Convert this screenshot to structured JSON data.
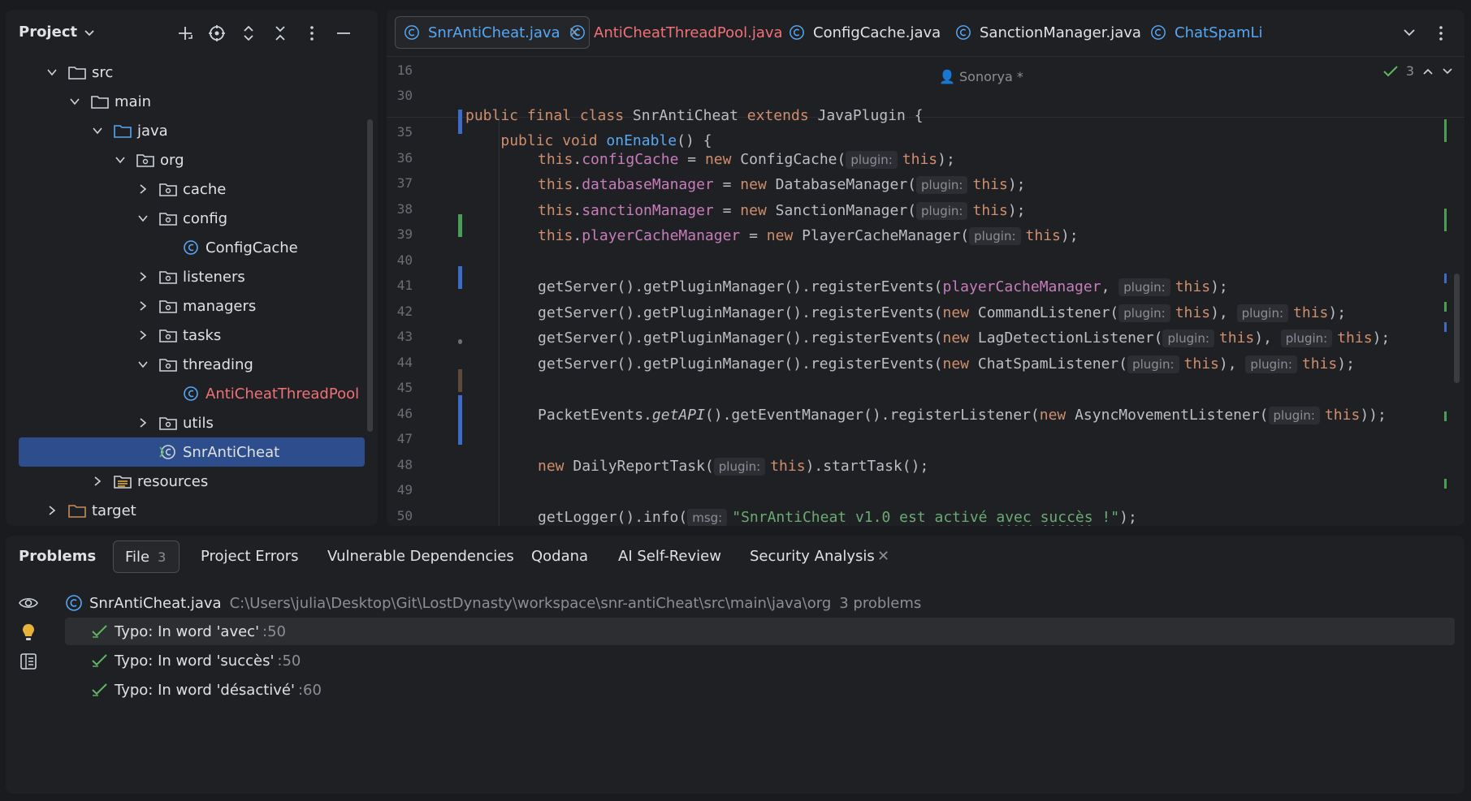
{
  "project": {
    "title": "Project",
    "tree": [
      {
        "label": "src",
        "kind": "folder",
        "expanded": true,
        "depth": 0
      },
      {
        "label": "main",
        "kind": "folder",
        "expanded": true,
        "depth": 1
      },
      {
        "label": "java",
        "kind": "source-folder",
        "expanded": true,
        "depth": 2
      },
      {
        "label": "org",
        "kind": "package",
        "expanded": true,
        "depth": 3
      },
      {
        "label": "cache",
        "kind": "package",
        "expanded": false,
        "depth": 4
      },
      {
        "label": "config",
        "kind": "package",
        "expanded": true,
        "depth": 4
      },
      {
        "label": "ConfigCache",
        "kind": "class",
        "depth": 5
      },
      {
        "label": "listeners",
        "kind": "package",
        "expanded": false,
        "depth": 4
      },
      {
        "label": "managers",
        "kind": "package",
        "expanded": false,
        "depth": 4
      },
      {
        "label": "tasks",
        "kind": "package",
        "expanded": false,
        "depth": 4
      },
      {
        "label": "threading",
        "kind": "package",
        "expanded": true,
        "depth": 4
      },
      {
        "label": "AntiCheatThreadPool",
        "kind": "class-error",
        "depth": 5
      },
      {
        "label": "utils",
        "kind": "package",
        "expanded": false,
        "depth": 4
      },
      {
        "label": "SnrAntiCheat",
        "kind": "main-class",
        "depth": 4,
        "selected": true
      },
      {
        "label": "resources",
        "kind": "resources-folder",
        "expanded": false,
        "depth": 2
      },
      {
        "label": "target",
        "kind": "folder-excluded",
        "expanded": false,
        "depth": 0
      }
    ]
  },
  "editor": {
    "tabs": [
      {
        "label": "SnrAntiCheat.java",
        "active": true,
        "color": "#56a8f5"
      },
      {
        "label": "AntiCheatThreadPool.java",
        "active": false,
        "color": "#f07178"
      },
      {
        "label": "ConfigCache.java",
        "active": false,
        "color": "#dfe1e5"
      },
      {
        "label": "SanctionManager.java",
        "active": false,
        "color": "#dfe1e5"
      },
      {
        "label": "ChatSpamLi",
        "active": false,
        "color": "#56a8f5"
      }
    ],
    "author": "Sonorya *",
    "inspection_count": "3",
    "sticky": [
      {
        "ln": "16",
        "code": "public final class SnrAntiCheat extends JavaPlugin {"
      },
      {
        "ln": "30",
        "code": "    public void onEnable() {"
      }
    ],
    "line_numbers": [
      "35",
      "36",
      "37",
      "38",
      "39",
      "40",
      "41",
      "42",
      "43",
      "44",
      "45",
      "46",
      "47",
      "48",
      "49",
      "50"
    ],
    "hint_plugin": "plugin:",
    "hint_msg": "msg:",
    "log_message": "\"SnrAntiCheat v1.0 est activé avec succès !\""
  },
  "problems": {
    "title": "Problems",
    "tabs": [
      {
        "label": "File",
        "count": "3"
      },
      {
        "label": "Project Errors"
      },
      {
        "label": "Vulnerable Dependencies"
      },
      {
        "label": "Qodana"
      },
      {
        "label": "AI Self-Review"
      },
      {
        "label": "Security Analysis"
      }
    ],
    "file": {
      "name": "SnrAntiCheat.java",
      "path": "C:\\Users\\julia\\Desktop\\Git\\LostDynasty\\workspace\\snr-antiCheat\\src\\main\\java\\org",
      "count": "3 problems"
    },
    "items": [
      {
        "text": "Typo: In word 'avec'",
        "line": ":50"
      },
      {
        "text": "Typo: In word 'succès'",
        "line": ":50"
      },
      {
        "text": "Typo: In word 'désactivé'",
        "line": ":60"
      }
    ]
  }
}
